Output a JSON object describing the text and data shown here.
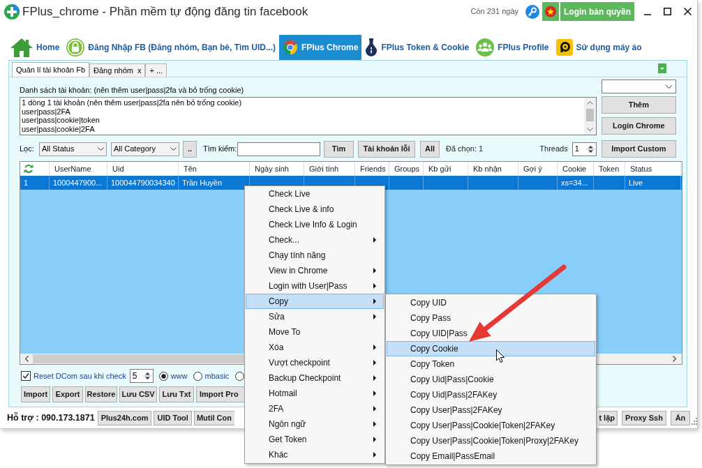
{
  "window": {
    "title": "FPlus_chrome - Phần mềm tự động đăng tin facebook",
    "days_left": "Còn 231 ngày",
    "license_button": "Login bản quyền"
  },
  "main_tabs": [
    {
      "kind": "home",
      "label": "Home",
      "selected": false
    },
    {
      "kind": "login",
      "label": "Đăng Nhập FB (Đăng nhóm, Bạn bè, Tìm UID...)",
      "selected": false
    },
    {
      "kind": "chrome",
      "label": "FPlus Chrome",
      "selected": true
    },
    {
      "kind": "token",
      "label": "FPlus Token & Cookie",
      "selected": false
    },
    {
      "kind": "profile",
      "label": "FPlus Profile",
      "selected": false
    },
    {
      "kind": "vm",
      "label": "Sử dụng máy ảo",
      "selected": false
    }
  ],
  "sub_tabs": [
    {
      "label": "Quản lí tài khoản Fb",
      "selected": true
    },
    {
      "label": "Đăng nhóm",
      "close_label": "x",
      "selected": false
    },
    {
      "label": "+ ...",
      "selected": false
    }
  ],
  "accounts": {
    "label": "Danh sách tài khoản: (nên thêm user|pass|2fa và bỏ trống cookie)",
    "lines": [
      "1 dòng 1 tài khoản (nên thêm user|pass|2fa nên bỏ trống cookie)",
      "user|pass|2FA",
      "user|pass|cookie|token",
      "user|pass|cookie|2FA"
    ]
  },
  "side_buttons": [
    "Thêm",
    "Login Chrome",
    "Import Custom"
  ],
  "filter": {
    "label": "Lọc:",
    "status": "All Status",
    "category": "All Category",
    "more_button": "..",
    "search_label": "Tìm kiếm:",
    "search_button": "Tìm",
    "error_button": "Tài khoản lỗi",
    "all_button": "All",
    "selected_count": "Đã chọn: 1",
    "threads_label": "Threads",
    "threads_value": "1"
  },
  "table": {
    "columns": [
      "",
      "UserName",
      "Uid",
      "Tên",
      "Ngày sinh",
      "Giới tính",
      "Friends",
      "Groups",
      "Kb gửi",
      "Kb nhận",
      "Gợi ý",
      "Cookie",
      "Token",
      "Status"
    ],
    "rows": [
      {
        "selected": true,
        "cells": [
          "1",
          "1000447900...",
          "100044790034340",
          "Trần Huyền",
          null,
          null,
          null,
          null,
          null,
          null,
          null,
          "xs=34...",
          null,
          "Live"
        ]
      }
    ]
  },
  "options": {
    "reset_dcom": {
      "label": "Reset DCom sau khi check",
      "checked": true
    },
    "delay": "5",
    "radios": [
      {
        "label": "www",
        "selected": true
      },
      {
        "label": "mbasic",
        "selected": false
      },
      {
        "selected": false
      }
    ]
  },
  "action_buttons": [
    "Import",
    "Export",
    "Restore",
    "Lưu CSV",
    "Lưu Txt",
    "Import Pro"
  ],
  "footer": {
    "support": "Hỗ trợ : 090.173.1871",
    "left_buttons": [
      "Plus24h.com",
      "UID Tool",
      "Mutil Con"
    ],
    "right_buttons": [
      "t lập",
      "Proxy Ssh",
      "Ẩn"
    ]
  },
  "context_menu": {
    "items": [
      {
        "label": "Check Live",
        "submenu": false,
        "selected": false
      },
      {
        "label": "Check Live & info",
        "submenu": false,
        "selected": false
      },
      {
        "label": "Check Live Info & Login",
        "submenu": false,
        "selected": false
      },
      {
        "label": "Check...",
        "submenu": true,
        "selected": false
      },
      {
        "label": "Chạy tính năng",
        "submenu": false,
        "selected": false
      },
      {
        "label": "View in Chrome",
        "submenu": true,
        "selected": false
      },
      {
        "label": "Login with User|Pass",
        "submenu": true,
        "selected": false
      },
      {
        "label": "Copy",
        "submenu": true,
        "selected": true
      },
      {
        "label": "Sửa",
        "submenu": true,
        "selected": false
      },
      {
        "label": "Move To",
        "submenu": false,
        "selected": false
      },
      {
        "label": "Xóa",
        "submenu": true,
        "selected": false
      },
      {
        "label": "Vượt checkpoint",
        "submenu": true,
        "selected": false
      },
      {
        "label": "Backup Checkpoint",
        "submenu": true,
        "selected": false
      },
      {
        "label": "Hotmail",
        "submenu": true,
        "selected": false
      },
      {
        "label": "2FA",
        "submenu": true,
        "selected": false
      },
      {
        "label": "Ngôn ngữ",
        "submenu": true,
        "selected": false
      },
      {
        "label": "Get Token",
        "submenu": true,
        "selected": false
      },
      {
        "label": "Khác",
        "submenu": true,
        "selected": false
      }
    ],
    "submenu_items": [
      {
        "label": "Copy UID",
        "selected": false
      },
      {
        "label": "Copy Pass",
        "selected": false
      },
      {
        "label": "Copy UID|Pass",
        "selected": false
      },
      {
        "label": "Copy Cookie",
        "selected": true
      },
      {
        "label": "Copy Token",
        "selected": false
      },
      {
        "label": "Copy Uid|Pass|Cookie",
        "selected": false
      },
      {
        "label": "Copy Uid|Pass|2FAKey",
        "selected": false
      },
      {
        "label": "Copy User|Pass|2FAKey",
        "selected": false
      },
      {
        "label": "Copy User|Pass|Cookie|Token|2FAKey",
        "selected": false
      },
      {
        "label": "Copy User|Pass|Cookie|Token|Proxy|2FAKey",
        "selected": false
      },
      {
        "label": "Copy Email|PassEmail",
        "selected": false
      }
    ]
  }
}
